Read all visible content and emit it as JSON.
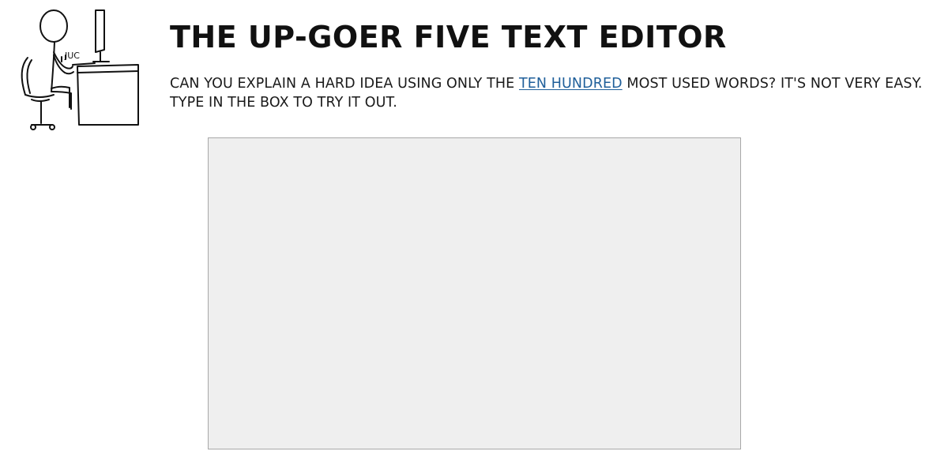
{
  "header": {
    "title": "THE UP-GOER FIVE TEXT EDITOR",
    "intro_before_link": "CAN YOU EXPLAIN A HARD IDEA USING ONLY THE ",
    "intro_link": "TEN HUNDRED",
    "intro_after_link": " MOST USED WORDS? IT'S NOT VERY EASY. TYPE IN THE BOX TO TRY IT OUT.",
    "link_color": "#1f5f9a"
  },
  "illustration": {
    "sound_text": "JUC",
    "icon": "stick-figure-at-desk-icon"
  },
  "editor": {
    "value": "",
    "background": "#efefef"
  }
}
